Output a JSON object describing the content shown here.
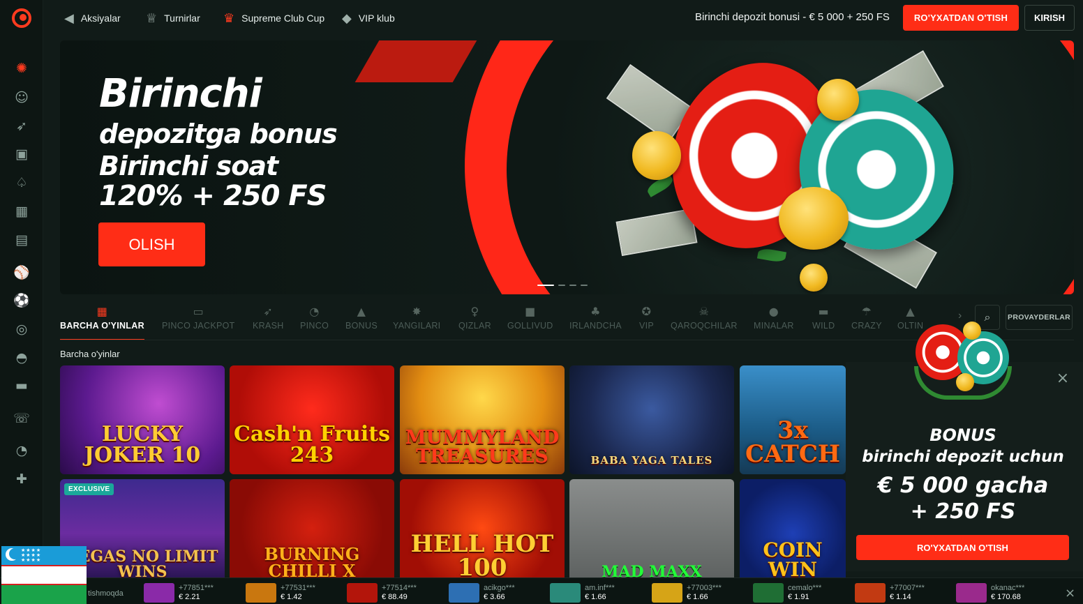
{
  "topbar": {
    "nav": [
      {
        "label": "Aksiyalar",
        "icon": "megaphone-icon"
      },
      {
        "label": "Turnirlar",
        "icon": "trophy-icon"
      },
      {
        "label": "Supreme Club Cup",
        "icon": "cup-icon"
      },
      {
        "label": "VIP klub",
        "icon": "diamond-icon"
      }
    ],
    "promo": "Birinchi depozit bonusi - € 5 000 + 250 FS",
    "register_label": "RO'YXATDAN O'TISH",
    "login_label": "KIRISH"
  },
  "sidebar": {
    "icons": [
      "casino-icon",
      "dealer-icon",
      "rocket-icon",
      "tv-games-icon",
      "poker-icon",
      "lottery-icon",
      "cards-icon",
      "sport-icon",
      "football-icon",
      "target-icon",
      "gamepad-icon",
      "news-icon",
      "support-icon",
      "pinco-icon",
      "gift-icon"
    ]
  },
  "hero": {
    "title": "Birinchi",
    "line1": "depozitga bonus",
    "line2": "Birinchi soat",
    "line3": "120% + 250 FS",
    "button": "OLISH",
    "active_slide": 1,
    "slide_count": 4
  },
  "categories": {
    "items": [
      {
        "label": "BARCHA O'YINLAR",
        "icon": "grid-icon",
        "active": true
      },
      {
        "label": "PINCO JACKPOT",
        "icon": "jackpot-icon"
      },
      {
        "label": "KRASH",
        "icon": "rocket-icon"
      },
      {
        "label": "PINCO",
        "icon": "pinco-icon"
      },
      {
        "label": "BONUS",
        "icon": "bonus-icon"
      },
      {
        "label": "YANGILARI",
        "icon": "new-icon"
      },
      {
        "label": "QIZLAR",
        "icon": "girl-icon"
      },
      {
        "label": "GOLLIVUD",
        "icon": "camera-icon"
      },
      {
        "label": "IRLANDCHA",
        "icon": "clover-icon"
      },
      {
        "label": "VIP",
        "icon": "vip-icon"
      },
      {
        "label": "QAROQCHILAR",
        "icon": "skull-icon"
      },
      {
        "label": "MINALAR",
        "icon": "bomb-icon"
      },
      {
        "label": "WILD",
        "icon": "wild-icon"
      },
      {
        "label": "CRAZY",
        "icon": "crazy-icon"
      },
      {
        "label": "OLTIN",
        "icon": "gold-icon"
      }
    ],
    "providers_label": "PROVAYDERLAR"
  },
  "games_section": {
    "title": "Barcha o'yinlar",
    "row1": [
      {
        "name": "LUCKY JOKER 10"
      },
      {
        "name": "Cash'n Fruits 243"
      },
      {
        "name": "MUMMYLAND TREASURES"
      },
      {
        "name": "BABA YAGA TALES"
      },
      {
        "name": "3x CATCH"
      }
    ],
    "row2": [
      {
        "name": "VEGAS NO LIMIT WINS",
        "badge": "EXCLUSIVE"
      },
      {
        "name": "BURNING CHILLI X"
      },
      {
        "name": "HELL HOT 100"
      },
      {
        "name": "MAD MAXX"
      },
      {
        "name": "COIN WIN"
      }
    ]
  },
  "popup": {
    "line1": "BONUS",
    "line2": "birinchi depozit uchun",
    "line3": "€ 5 000 gacha",
    "line4": "+ 250 FS",
    "button": "RO'YXATDAN O'TISH"
  },
  "ticker": {
    "label": "tishmoqda",
    "wins": [
      {
        "user": "+77851***",
        "amount": "€ 2.21",
        "color": "#8a2aa8"
      },
      {
        "user": "+77531***",
        "amount": "€ 1.42",
        "color": "#c9770f"
      },
      {
        "user": "+77514***",
        "amount": "€ 88.49",
        "color": "#b3150b"
      },
      {
        "user": "acikgo***",
        "amount": "€ 3.66",
        "color": "#2d6fb3"
      },
      {
        "user": "am.inf***",
        "amount": "€ 1.66",
        "color": "#2a8a7a"
      },
      {
        "user": "+77003***",
        "amount": "€ 1.66",
        "color": "#d6a417"
      },
      {
        "user": "cemalo***",
        "amount": "€ 1.91",
        "color": "#1f6e34"
      },
      {
        "user": "+77007***",
        "amount": "€ 1.14",
        "color": "#c23a12"
      },
      {
        "user": "okanac***",
        "amount": "€ 170.68",
        "color": "#9a2a8c"
      }
    ]
  },
  "colors": {
    "accent": "#ff2d16",
    "background": "#111b18",
    "teal": "#1fa593"
  }
}
